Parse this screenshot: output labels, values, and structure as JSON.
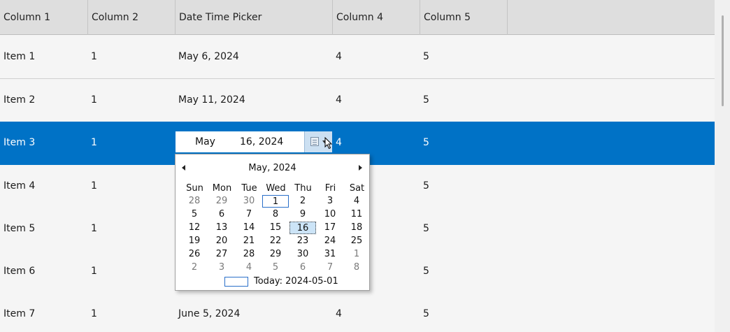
{
  "columns": [
    "Column 1",
    "Column 2",
    "Date Time Picker",
    "Column 4",
    "Column 5"
  ],
  "rows": [
    {
      "c1": "Item 1",
      "c2": "1",
      "c3": "May 6, 2024",
      "c4": "4",
      "c5": "5"
    },
    {
      "c1": "Item 2",
      "c2": "1",
      "c3": "May 11, 2024",
      "c4": "4",
      "c5": "5"
    },
    {
      "c1": "Item 3",
      "c2": "1",
      "c3": "",
      "c4": "4",
      "c5": "5"
    },
    {
      "c1": "Item 4",
      "c2": "1",
      "c3": "",
      "c4": "",
      "c5": "5"
    },
    {
      "c1": "Item 5",
      "c2": "1",
      "c3": "",
      "c4": "",
      "c5": "5"
    },
    {
      "c1": "Item 6",
      "c2": "1",
      "c3": "",
      "c4": "",
      "c5": "5"
    },
    {
      "c1": "Item 7",
      "c2": "1",
      "c3": "June 5, 2024",
      "c4": "4",
      "c5": "5"
    }
  ],
  "editor": {
    "month": "May",
    "day_year": "16, 2024",
    "icon": "calendar-icon"
  },
  "calendar": {
    "title": "May, 2024",
    "weekdays": [
      "Sun",
      "Mon",
      "Tue",
      "Wed",
      "Thu",
      "Fri",
      "Sat"
    ],
    "weeks": [
      [
        "28",
        "29",
        "30",
        "1",
        "2",
        "3",
        "4"
      ],
      [
        "5",
        "6",
        "7",
        "8",
        "9",
        "10",
        "11"
      ],
      [
        "12",
        "13",
        "14",
        "15",
        "16",
        "17",
        "18"
      ],
      [
        "19",
        "20",
        "21",
        "22",
        "23",
        "24",
        "25"
      ],
      [
        "26",
        "27",
        "28",
        "29",
        "30",
        "31",
        "1"
      ],
      [
        "2",
        "3",
        "4",
        "5",
        "6",
        "7",
        "8"
      ]
    ],
    "today_label": "Today: 2024-05-01"
  },
  "colors": {
    "selected_row": "#0072c6",
    "header": "#dedede",
    "row": "#f5f5f5"
  }
}
